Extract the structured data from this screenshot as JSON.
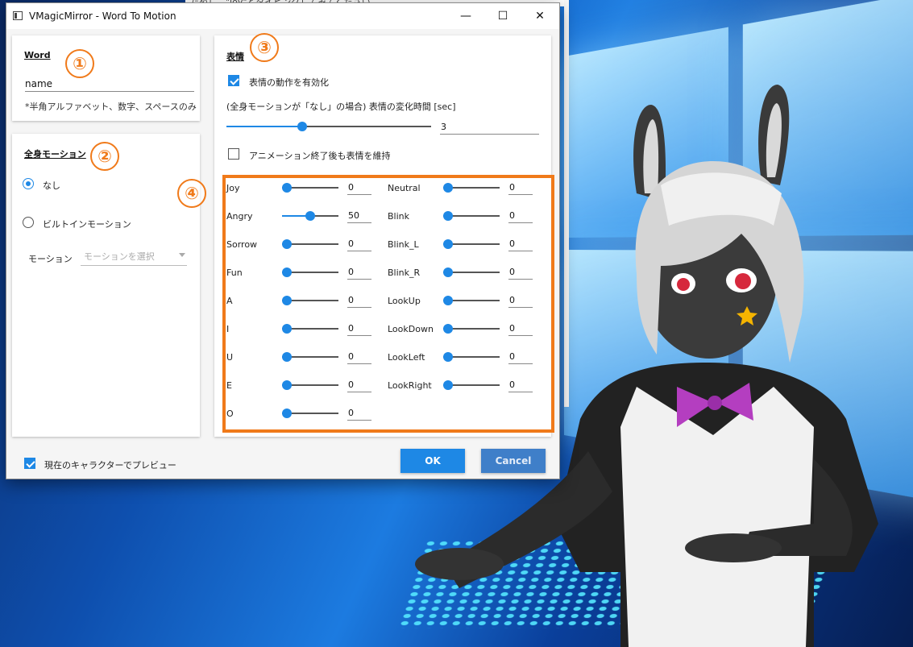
{
  "window": {
    "title": "VMagicMirror - Word To Motion"
  },
  "titlebar_buttons": {
    "minimize": "—",
    "maximize": "☐",
    "close": "✕"
  },
  "background_window": {
    "title_fragment": "ためし、\"joy\"とタイピングしてみてください"
  },
  "markers": [
    "①",
    "②",
    "③",
    "④"
  ],
  "word": {
    "heading": "Word",
    "value": "name",
    "hint": "*半角アルファベット、数字、スペースのみ"
  },
  "body_motion": {
    "heading": "全身モーション",
    "option_none": "なし",
    "option_builtin": "ビルトインモーション",
    "selected": "なし",
    "motion_label": "モーション",
    "motion_placeholder": "モーションを選択"
  },
  "expression": {
    "heading": "表情",
    "enable_label": "表情の動作を有効化",
    "enable_checked": true,
    "duration_label": "(全身モーションが「なし」の場合) 表情の変化時間 [sec]",
    "duration_value": "3",
    "duration_fraction": 0.37,
    "keep_label": "アニメーション終了後も表情を維持",
    "keep_checked": false
  },
  "blendshapes_left": [
    {
      "name": "Joy",
      "value": "0"
    },
    {
      "name": "Angry",
      "value": "50"
    },
    {
      "name": "Sorrow",
      "value": "0"
    },
    {
      "name": "Fun",
      "value": "0"
    },
    {
      "name": "A",
      "value": "0"
    },
    {
      "name": "I",
      "value": "0"
    },
    {
      "name": "U",
      "value": "0"
    },
    {
      "name": "E",
      "value": "0"
    },
    {
      "name": "O",
      "value": "0"
    }
  ],
  "blendshapes_right": [
    {
      "name": "Neutral",
      "value": "0"
    },
    {
      "name": "Blink",
      "value": "0"
    },
    {
      "name": "Blink_L",
      "value": "0"
    },
    {
      "name": "Blink_R",
      "value": "0"
    },
    {
      "name": "LookUp",
      "value": "0"
    },
    {
      "name": "LookDown",
      "value": "0"
    },
    {
      "name": "LookLeft",
      "value": "0"
    },
    {
      "name": "LookRight",
      "value": "0"
    }
  ],
  "footer": {
    "preview_label": "現在のキャラクターでプレビュー",
    "preview_checked": true,
    "ok_label": "OK",
    "cancel_label": "Cancel"
  },
  "colors": {
    "accent": "#1e88e5",
    "annotation": "#f07a1a"
  }
}
